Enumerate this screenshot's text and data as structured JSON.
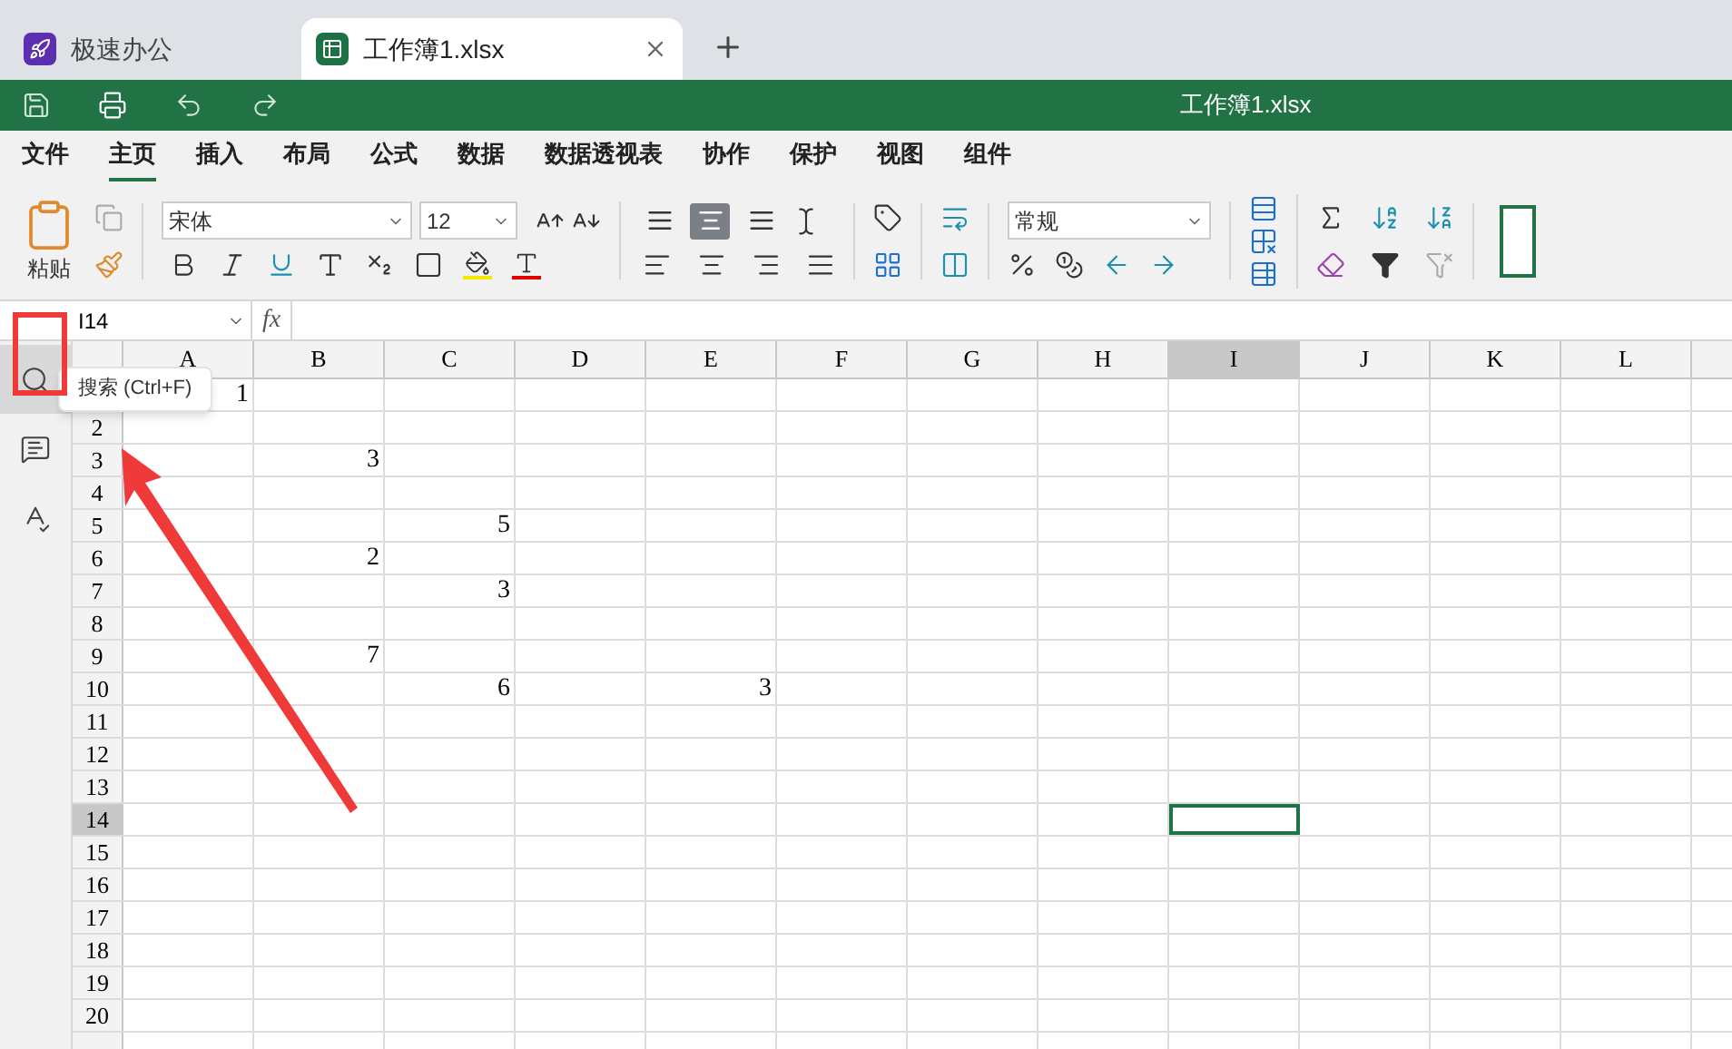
{
  "tabs": [
    {
      "title": "极速办公",
      "kind": "app",
      "selected": false
    },
    {
      "title": "工作簿1.xlsx",
      "kind": "sheet",
      "selected": true
    }
  ],
  "quick_toolbar": {
    "title": "工作簿1.xlsx"
  },
  "menu": [
    {
      "label": "文件",
      "selected": false
    },
    {
      "label": "主页",
      "selected": true
    },
    {
      "label": "插入",
      "selected": false
    },
    {
      "label": "布局",
      "selected": false
    },
    {
      "label": "公式",
      "selected": false
    },
    {
      "label": "数据",
      "selected": false
    },
    {
      "label": "数据透视表",
      "selected": false
    },
    {
      "label": "协作",
      "selected": false
    },
    {
      "label": "保护",
      "selected": false
    },
    {
      "label": "视图",
      "selected": false
    },
    {
      "label": "组件",
      "selected": false
    }
  ],
  "ribbon": {
    "paste_label": "粘贴",
    "font_name": "宋体",
    "font_size": "12",
    "number_format": "常规",
    "vertical_align": [
      {
        "selected": false
      },
      {
        "selected": true
      },
      {
        "selected": false
      }
    ]
  },
  "formula_bar": {
    "name_box": "I14",
    "fx": "fx"
  },
  "sidebar": [
    {
      "kind": "search",
      "selected": true
    },
    {
      "kind": "comment",
      "selected": false
    },
    {
      "kind": "spellcheck",
      "selected": false
    }
  ],
  "tooltip": "搜索 (Ctrl+F)",
  "columns": [
    {
      "label": "A",
      "selected": false
    },
    {
      "label": "B",
      "selected": false
    },
    {
      "label": "C",
      "selected": false
    },
    {
      "label": "D",
      "selected": false
    },
    {
      "label": "E",
      "selected": false
    },
    {
      "label": "F",
      "selected": false
    },
    {
      "label": "G",
      "selected": false
    },
    {
      "label": "H",
      "selected": false
    },
    {
      "label": "I",
      "selected": true
    },
    {
      "label": "J",
      "selected": false
    },
    {
      "label": "K",
      "selected": false
    },
    {
      "label": "L",
      "selected": false
    }
  ],
  "rows": [
    {
      "cells": [
        "1"
      ]
    },
    {
      "label": "2",
      "selected": false,
      "cells": []
    },
    {
      "label": "3",
      "selected": false,
      "cells": [
        null,
        "3"
      ]
    },
    {
      "label": "4",
      "selected": false,
      "cells": []
    },
    {
      "label": "5",
      "selected": false,
      "cells": [
        null,
        null,
        "5"
      ]
    },
    {
      "label": "6",
      "selected": false,
      "cells": [
        null,
        "2"
      ]
    },
    {
      "label": "7",
      "selected": false,
      "cells": [
        null,
        null,
        "3"
      ]
    },
    {
      "label": "8",
      "selected": false,
      "cells": []
    },
    {
      "label": "9",
      "selected": false,
      "cells": [
        null,
        "7"
      ]
    },
    {
      "label": "10",
      "selected": false,
      "cells": [
        null,
        null,
        "6",
        null,
        "3"
      ]
    },
    {
      "label": "11",
      "selected": false,
      "cells": []
    },
    {
      "label": "12",
      "selected": false,
      "cells": []
    },
    {
      "label": "13",
      "selected": false,
      "cells": []
    },
    {
      "label": "14",
      "selected": true,
      "cells": []
    },
    {
      "label": "15",
      "selected": false,
      "cells": []
    },
    {
      "label": "16",
      "selected": false,
      "cells": []
    },
    {
      "label": "17",
      "selected": false,
      "cells": []
    },
    {
      "label": "18",
      "selected": false,
      "cells": []
    },
    {
      "label": "19",
      "selected": false,
      "cells": []
    },
    {
      "label": "20",
      "selected": false,
      "cells": []
    }
  ]
}
